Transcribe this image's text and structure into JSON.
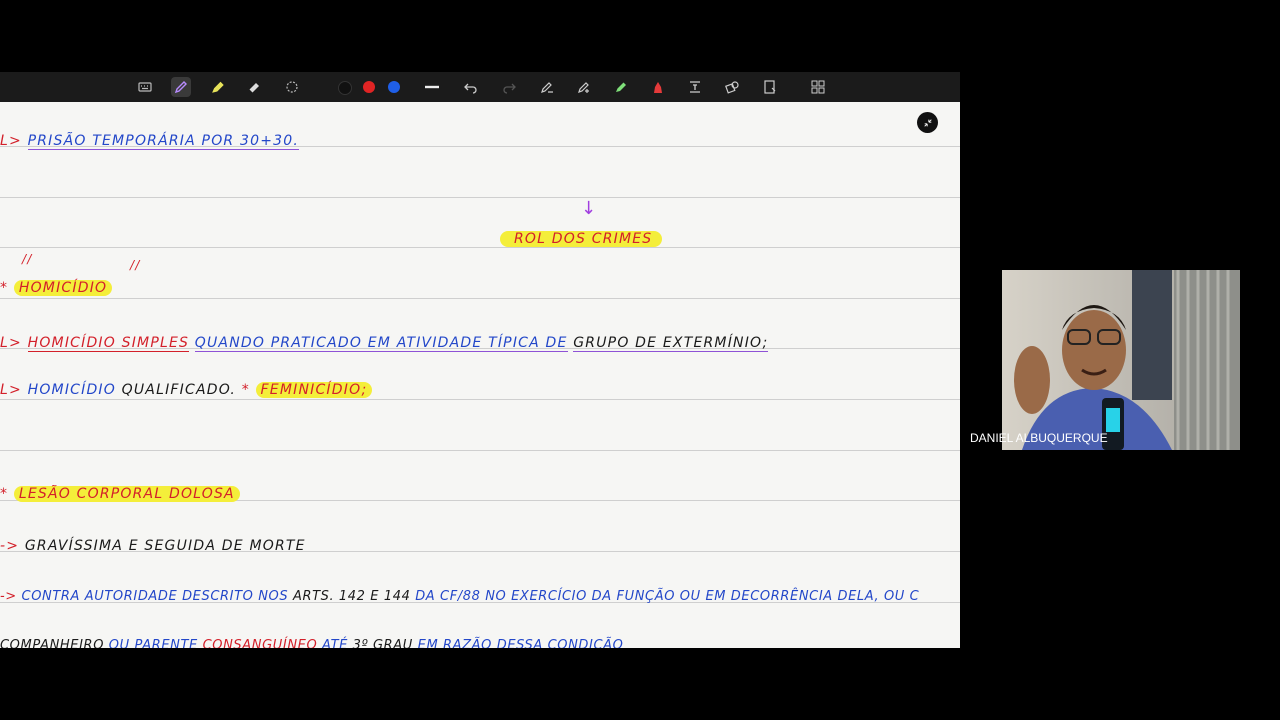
{
  "toolbar": {
    "tools": [
      "keyboard-icon",
      "pen-icon",
      "highlighter-icon",
      "eraser-icon",
      "lasso-icon"
    ],
    "colors": [
      "#111111",
      "#e02424",
      "#1f5fe8"
    ],
    "actions": [
      "line-width-icon",
      "undo-icon",
      "redo-icon",
      "pen-edit-icon",
      "pen-add-icon",
      "highlighter-green-icon",
      "red-pen-icon",
      "text-icon",
      "shapes-icon",
      "page-icon",
      "grid-icon"
    ]
  },
  "notes": {
    "line1": {
      "arrow": "L>",
      "text": "PRISÃO TEMPORÁRIA  POR 30+30."
    },
    "arrow_mark": "↓",
    "heading": "ROL DOS CRIMES",
    "ditto1": "//",
    "ditto2": "//",
    "item1": {
      "star": "*",
      "text": "HOMICÍDIO"
    },
    "line3": {
      "arrow": "L>",
      "red": "HOMICÍDIO SIMPLES",
      "blue": "QUANDO PRATICADO EM ATIVIDADE TÍPICA DE",
      "black": "GRUPO DE EXTERMÍNIO;"
    },
    "line4": {
      "arrow": "L>",
      "blue": "HOMICÍDIO",
      "black": "QUALIFICADO.",
      "star": "*",
      "red": "FEMINICÍDIO;"
    },
    "item2": {
      "star": "*",
      "text": "LESÃO CORPORAL DOLOSA"
    },
    "line6": {
      "arrow": "->",
      "text": "GRAVÍSSIMA E SEGUIDA DE MORTE"
    },
    "line7": {
      "arrow": "->",
      "blue1": "CONTRA AUTORIDADE DESCRITO NOS",
      "black": "ARTS. 142 E 144",
      "blue2": "DA CF/88  NO  EXERCÍCIO  DA FUNÇÃO  OU EM DECORRÊNCIA DELA, OU C"
    },
    "line8": {
      "black": "COMPANHEIRO",
      "blue1": "OU PARENTE",
      "red": "CONSANGUÍNEO",
      "blue2": "ATÉ",
      "black2": "3º GRAU",
      "blue3": "EM RAZÃO DESSA CONDIÇÃO"
    }
  },
  "participant": {
    "name": "DANIEL ALBUQUERQUE"
  }
}
